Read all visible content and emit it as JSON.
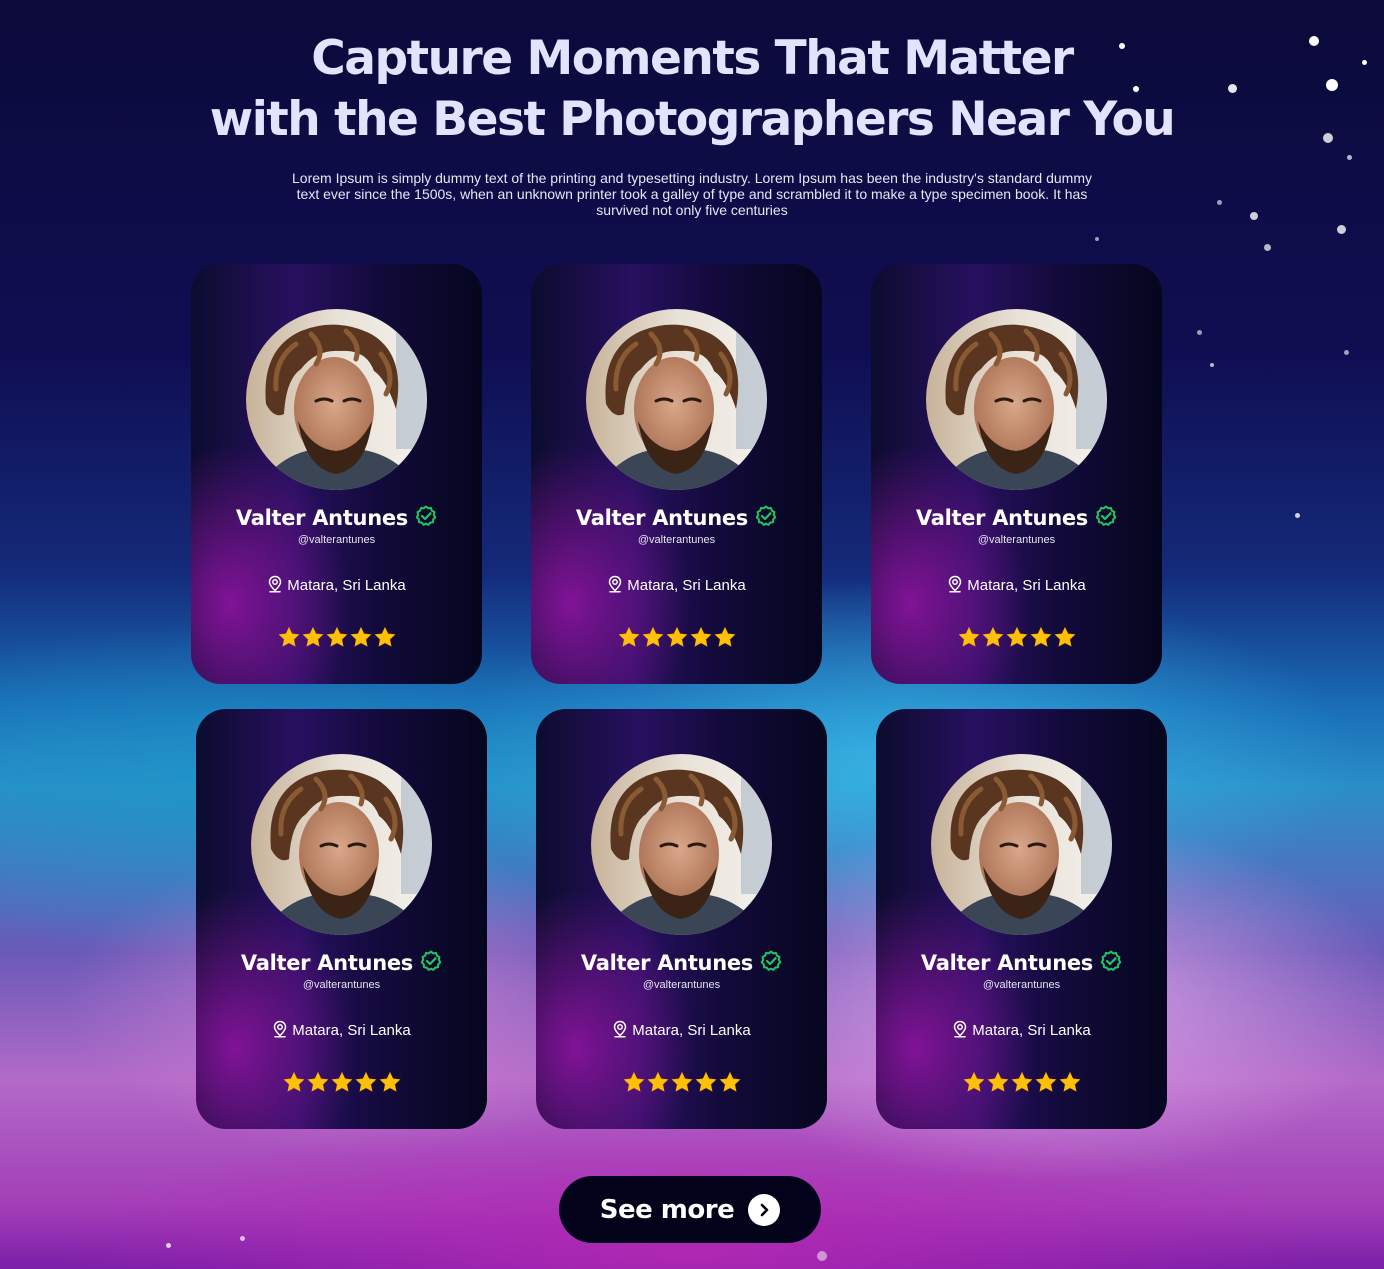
{
  "hero": {
    "title_line1": "Capture Moments That Matter",
    "title_line2": "with the Best Photographers Near You",
    "description": "Lorem Ipsum is simply dummy text of the printing and typesetting industry. Lorem Ipsum has been the industry's standard dummy text ever since the 1500s, when an unknown printer took a galley of type and scrambled it to make a type specimen book. It has survived not only five centuries"
  },
  "photographers": [
    {
      "name": "Valter Antunes",
      "handle": "@valterantunes",
      "location": "Matara, Sri Lanka",
      "rating": 5,
      "verified": true
    },
    {
      "name": "Valter Antunes",
      "handle": "@valterantunes",
      "location": "Matara, Sri Lanka",
      "rating": 5,
      "verified": true
    },
    {
      "name": "Valter Antunes",
      "handle": "@valterantunes",
      "location": "Matara, Sri Lanka",
      "rating": 5,
      "verified": true
    },
    {
      "name": "Valter Antunes",
      "handle": "@valterantunes",
      "location": "Matara, Sri Lanka",
      "rating": 5,
      "verified": true
    },
    {
      "name": "Valter Antunes",
      "handle": "@valterantunes",
      "location": "Matara, Sri Lanka",
      "rating": 5,
      "verified": true
    },
    {
      "name": "Valter Antunes",
      "handle": "@valterantunes",
      "location": "Matara, Sri Lanka",
      "rating": 5,
      "verified": true
    }
  ],
  "see_more": {
    "label": "See more",
    "icon": "chevron-right-icon"
  },
  "colors": {
    "verified": "#22c55e",
    "star": "#ffc107",
    "button_bg": "#02021a"
  }
}
